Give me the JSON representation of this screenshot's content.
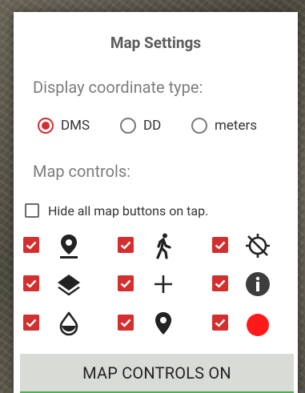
{
  "dialog": {
    "title": "Map Settings",
    "coord_label": "Display coordinate type:",
    "coord_options": [
      {
        "label": "DMS",
        "selected": true
      },
      {
        "label": "DD",
        "selected": false
      },
      {
        "label": "meters",
        "selected": false
      }
    ],
    "controls_label": "Map controls:",
    "hide_buttons": {
      "label": "Hide all map buttons on tap.",
      "checked": false
    },
    "controls": [
      {
        "icon": "location-pin-icon",
        "checked": true
      },
      {
        "icon": "walking-person-icon",
        "checked": true
      },
      {
        "icon": "gps-off-icon",
        "checked": true
      },
      {
        "icon": "layers-icon",
        "checked": true
      },
      {
        "icon": "plus-icon",
        "checked": true
      },
      {
        "icon": "info-icon",
        "checked": true
      },
      {
        "icon": "water-drop-icon",
        "checked": true
      },
      {
        "icon": "place-marker-icon",
        "checked": true
      },
      {
        "icon": "record-dot-icon",
        "checked": true
      }
    ],
    "colors": {
      "accent": "#d32f2f",
      "button_bg": "#d9dbd7",
      "button_underline": "#4caf50"
    },
    "bottom_button": "MAP CONTROLS ON"
  }
}
